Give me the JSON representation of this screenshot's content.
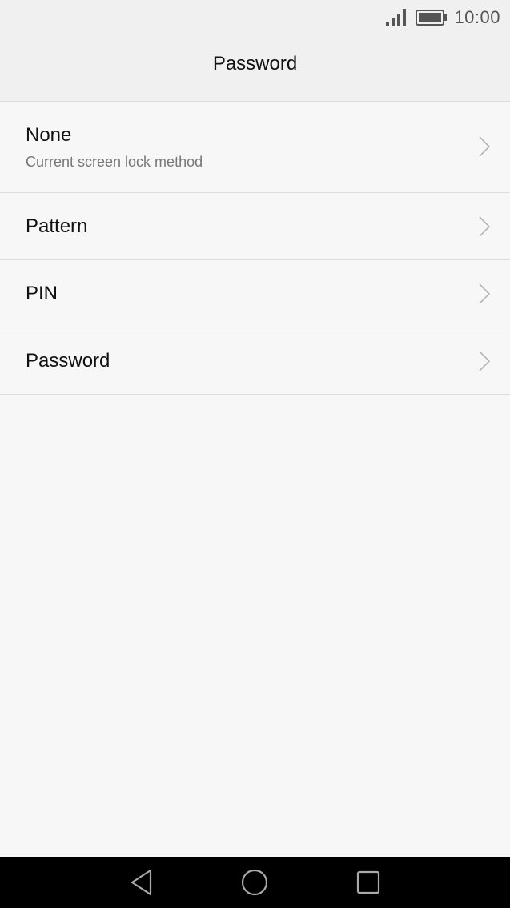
{
  "status_bar": {
    "time": "10:00",
    "signal_icon": "signal-icon",
    "battery_icon": "battery-icon"
  },
  "app_bar": {
    "title": "Password"
  },
  "options": [
    {
      "title": "None",
      "subtitle": "Current screen lock method",
      "icon": "chevron-right-icon"
    },
    {
      "title": "Pattern",
      "icon": "chevron-right-icon"
    },
    {
      "title": "PIN",
      "icon": "chevron-right-icon"
    },
    {
      "title": "Password",
      "icon": "chevron-right-icon"
    }
  ],
  "nav_bar": {
    "back_icon": "back-triangle-icon",
    "home_icon": "home-circle-icon",
    "recents_icon": "recents-square-icon"
  },
  "colors": {
    "background": "#f7f7f7",
    "app_bar": "#f0f0f0",
    "nav_bar": "#000000",
    "text_primary": "#111111",
    "text_secondary": "#777777"
  }
}
